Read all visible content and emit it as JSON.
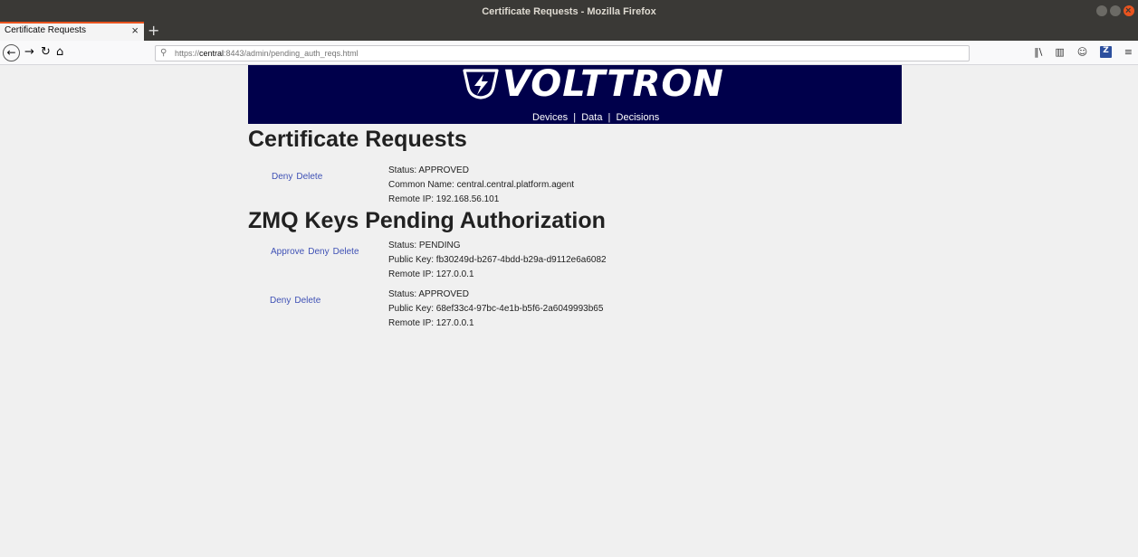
{
  "window": {
    "title": "Certificate Requests - Mozilla Firefox"
  },
  "tabs": [
    {
      "label": "Certificate Requests"
    }
  ],
  "url": {
    "prefix": "https://",
    "host": "central",
    "rest": ":8443/admin/pending_auth_reqs.html"
  },
  "banner": {
    "logo_text": "VOLTTRON",
    "tm": "™",
    "tagline": "Devices  |  Data  |  Decisions"
  },
  "cert_section": {
    "heading": "Certificate Requests",
    "items": [
      {
        "actions": [
          "Deny",
          "Delete"
        ],
        "status": "Status: APPROVED",
        "name": "Common Name: central.central.platform.agent",
        "ip": "Remote IP: 192.168.56.101"
      }
    ]
  },
  "zmq_section": {
    "heading": "ZMQ Keys Pending Authorization",
    "items": [
      {
        "actions": [
          "Approve",
          "Deny",
          "Delete"
        ],
        "status": "Status: PENDING",
        "key": "Public Key: fb30249d-b267-4bdd-b29a-d9112e6a6082",
        "ip": "Remote IP: 127.0.0.1"
      },
      {
        "actions": [
          "Deny",
          "Delete"
        ],
        "status": "Status: APPROVED",
        "key": "Public Key: 68ef33c4-97bc-4e1b-b5f6-2a6049993b65",
        "ip": "Remote IP: 127.0.0.1"
      }
    ]
  },
  "colors": {
    "banner_bg": "#00004b",
    "link": "#3f51b5",
    "tab_accent": "#e9541f"
  }
}
